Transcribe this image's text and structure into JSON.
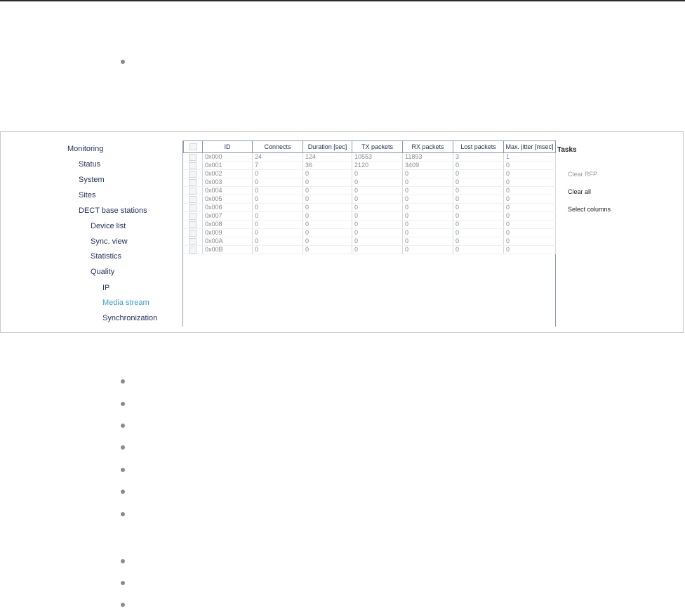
{
  "nav": {
    "items": [
      {
        "label": "Monitoring"
      },
      {
        "label": "Status"
      },
      {
        "label": "System"
      },
      {
        "label": "Sites"
      },
      {
        "label": "DECT base stations"
      },
      {
        "label": "Device list"
      },
      {
        "label": "Sync. view"
      },
      {
        "label": "Statistics"
      },
      {
        "label": "Quality"
      },
      {
        "label": "IP"
      },
      {
        "label": "Media stream"
      },
      {
        "label": "Synchronization"
      }
    ]
  },
  "grid": {
    "columns": [
      "ID",
      "Connects",
      "Duration [sec]",
      "TX packets",
      "RX packets",
      "Lost packets",
      "Max. jitter [msec]"
    ],
    "rows": [
      [
        "0x000",
        "24",
        "124",
        "10553",
        "11893",
        "3",
        "1"
      ],
      [
        "0x001",
        "7",
        "36",
        "2120",
        "3409",
        "0",
        "0"
      ],
      [
        "0x002",
        "0",
        "0",
        "0",
        "0",
        "0",
        "0"
      ],
      [
        "0x003",
        "0",
        "0",
        "0",
        "0",
        "0",
        "0"
      ],
      [
        "0x004",
        "0",
        "0",
        "0",
        "0",
        "0",
        "0"
      ],
      [
        "0x005",
        "0",
        "0",
        "0",
        "0",
        "0",
        "0"
      ],
      [
        "0x006",
        "0",
        "0",
        "0",
        "0",
        "0",
        "0"
      ],
      [
        "0x007",
        "0",
        "0",
        "0",
        "0",
        "0",
        "0"
      ],
      [
        "0x008",
        "0",
        "0",
        "0",
        "0",
        "0",
        "0"
      ],
      [
        "0x009",
        "0",
        "0",
        "0",
        "0",
        "0",
        "0"
      ],
      [
        "0x00A",
        "0",
        "0",
        "0",
        "0",
        "0",
        "0"
      ],
      [
        "0x00B",
        "0",
        "0",
        "0",
        "0",
        "0",
        "0"
      ]
    ]
  },
  "tasks": {
    "title": "Tasks",
    "clear_rfp": "Clear RFP",
    "clear_all": "Clear all",
    "select_columns": "Select columns"
  }
}
